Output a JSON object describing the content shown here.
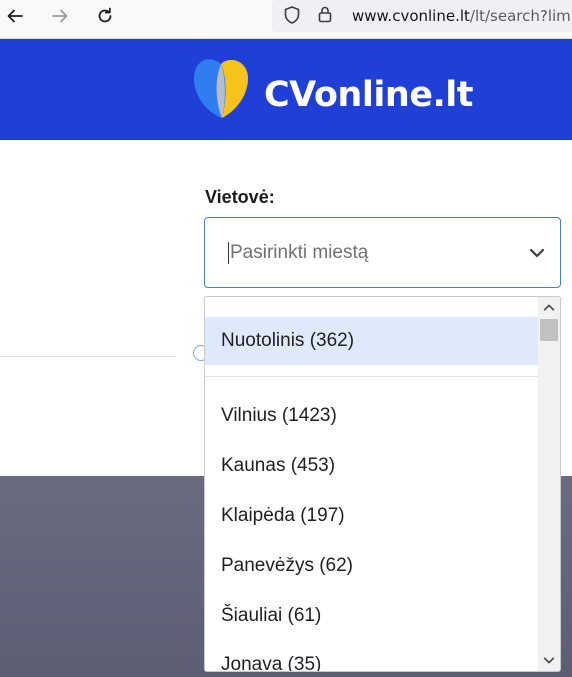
{
  "browser": {
    "url_host": "www.cvonline.lt",
    "url_path": "/lt/search?lim",
    "icons": [
      "back-arrow-icon",
      "forward-arrow-icon",
      "reload-icon",
      "shield-icon",
      "lock-icon"
    ]
  },
  "header": {
    "logo_text": "CVonline.lt",
    "background": "#1f3fd6"
  },
  "location": {
    "label": "Vietovė:",
    "placeholder": "Pasirinkti miestą",
    "options": [
      {
        "label": "Nuotolinis (362)",
        "highlighted": true
      },
      {
        "label": "Vilnius (1423)",
        "highlighted": false
      },
      {
        "label": "Kaunas (453)",
        "highlighted": false
      },
      {
        "label": "Klaipėda (197)",
        "highlighted": false
      },
      {
        "label": "Panevėžys (62)",
        "highlighted": false
      },
      {
        "label": "Šiauliai (61)",
        "highlighted": false
      },
      {
        "label": "Jonava (35)",
        "highlighted": false
      }
    ]
  },
  "colors": {
    "accent_border": "#4d7fc4",
    "highlight": "#deeafb"
  }
}
